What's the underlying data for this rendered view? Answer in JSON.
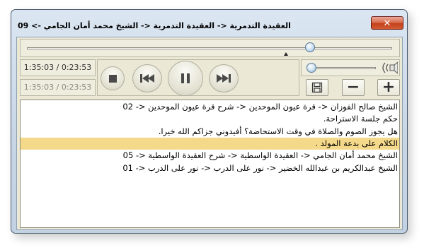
{
  "window": {
    "title": "09 <- العقيدة التدمرية <- العقيدة التدمرية <- الشيخ محمد أمان الجامي",
    "close_label": "✕"
  },
  "seek": {
    "position_fraction": 0.775
  },
  "times": {
    "primary": "1:35:03 / 0:23:53",
    "secondary": "1:35:03 / 0:23:53"
  },
  "controls": {
    "stop_icon": "stop-icon",
    "previous_icon": "previous-icon",
    "pause_icon": "pause-icon",
    "next_icon": "next-icon"
  },
  "volume": {
    "level_fraction": 0.0,
    "icon": "speaker-icon"
  },
  "buttons": {
    "save_icon": "floppy-disk-icon",
    "remove_label": "−",
    "add_label": "+"
  },
  "playlist": {
    "items": [
      {
        "text": "الشيخ صالح الفوزان <- قرة عيون الموحدين <- شرح قرة عيون الموحدين <- 02",
        "selected": false
      },
      {
        "text": "حكم جلسة الاستراحة.",
        "selected": false
      },
      {
        "text": "هل يجوز الصوم والصلاة في وقت الاستحاضة؟ أفيدوني جزاكم الله خيرا.",
        "selected": false
      },
      {
        "text": "الكلام على بدعة المولد .",
        "selected": true
      },
      {
        "text": "الشيخ محمد أمان الجامي <- العقيدة الواسطية <- شرح العقيدة الواسطية <- 05",
        "selected": false
      },
      {
        "text": "الشيخ عبدالكريم بن عبدالله الخضير <- نور على الدرب <- نور على الدرب <- 01",
        "selected": false
      }
    ]
  },
  "colors": {
    "selection": "#f5d98a",
    "panel": "#ebe9d6",
    "close_button": "#c2411c"
  }
}
